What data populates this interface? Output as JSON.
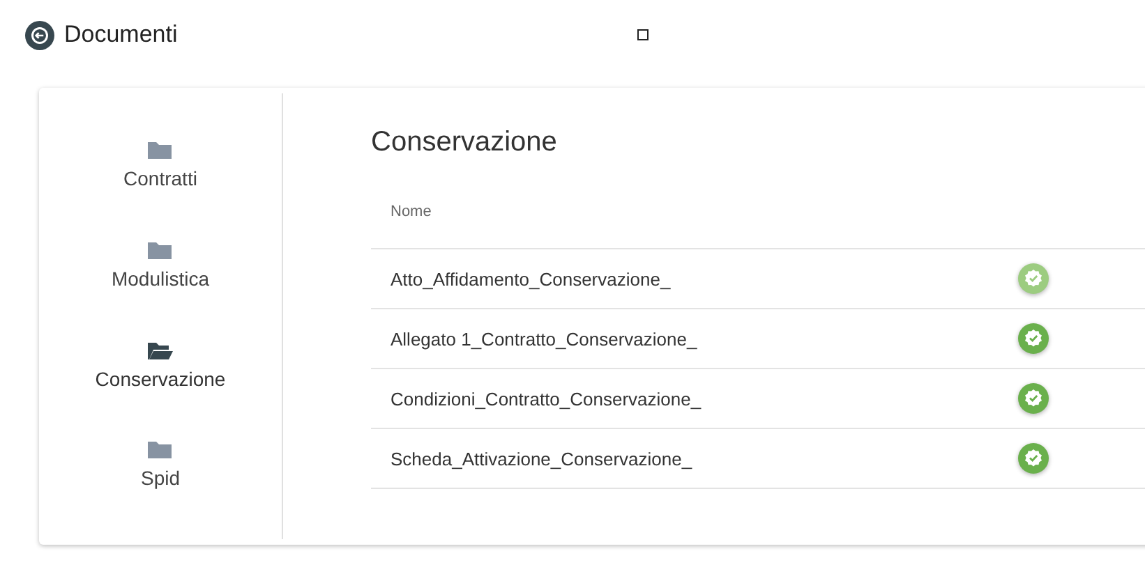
{
  "header": {
    "title": "Documenti"
  },
  "sidebar": {
    "items": [
      {
        "label": "Contratti",
        "selected": false
      },
      {
        "label": "Modulistica",
        "selected": false
      },
      {
        "label": "Conservazione",
        "selected": true
      },
      {
        "label": "Spid",
        "selected": false
      }
    ]
  },
  "content": {
    "title": "Conservazione",
    "table": {
      "columns": [
        "Nome"
      ],
      "rows": [
        {
          "name": "Atto_Affidamento_Conservazione_",
          "disabled": true
        },
        {
          "name": "Allegato 1_Contratto_Conservazione_",
          "disabled": false
        },
        {
          "name": "Condizioni_Contratto_Conservazione_",
          "disabled": false
        },
        {
          "name": "Scheda_Attivazione_Conservazione_",
          "disabled": false
        }
      ]
    }
  }
}
